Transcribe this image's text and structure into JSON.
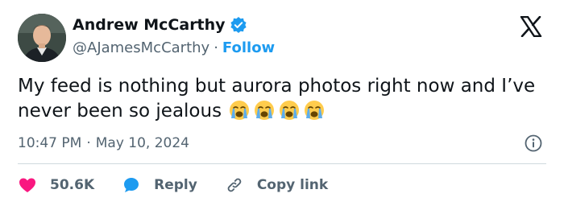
{
  "author": {
    "name": "Andrew McCarthy",
    "handle": "@AJamesMcCarthy",
    "separator": "·",
    "follow_label": "Follow"
  },
  "tweet": {
    "text": "My feed is nothing but aurora photos right now and I’ve never been so jealous",
    "emojis": [
      "loudly-crying-face",
      "loudly-crying-face",
      "loudly-crying-face",
      "loudly-crying-face"
    ]
  },
  "meta": {
    "time": "10:47 PM",
    "separator": "·",
    "date": "May 10, 2024"
  },
  "actions": {
    "likes_count": "50.6K",
    "reply_label": "Reply",
    "copy_link_label": "Copy link"
  },
  "colors": {
    "accent": "#1d9bf0",
    "like": "#f91880",
    "muted": "#536471",
    "text": "#0f1419",
    "divider": "#cfd9de"
  },
  "icons": [
    "verified-badge-icon",
    "x-logo-icon",
    "info-icon",
    "heart-icon",
    "reply-bubble-icon",
    "link-icon"
  ]
}
